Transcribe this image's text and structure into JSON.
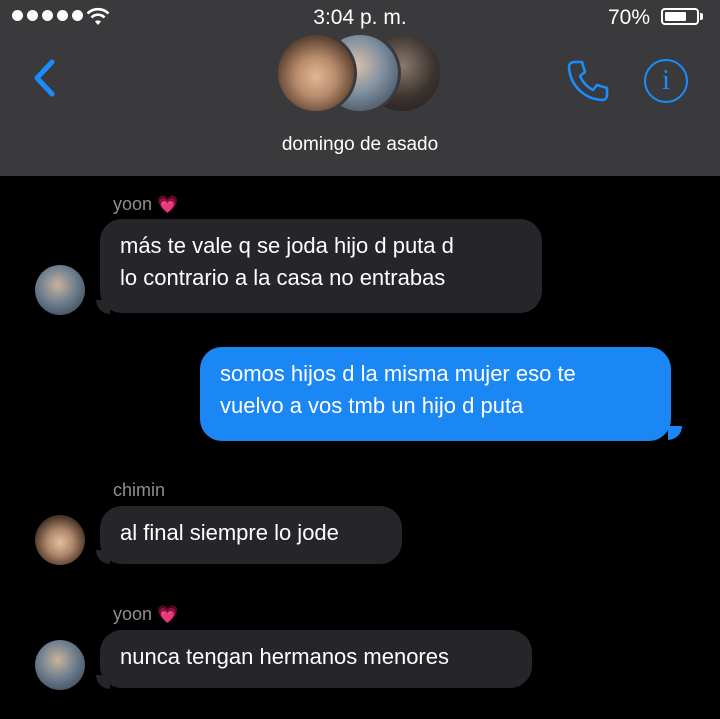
{
  "status_bar": {
    "time": "3:04 p. m.",
    "battery_percent": "70%",
    "battery_level": 0.7,
    "signal_dots": 5
  },
  "header": {
    "group_name": "domingo de asado",
    "back_icon": "chevron-left-icon",
    "call_icon": "phone-icon",
    "info_icon": "info-icon",
    "info_glyph": "i",
    "accent_color": "#1a8cff"
  },
  "messages": [
    {
      "sender": "yoon",
      "sender_emoji": "💗",
      "direction": "incoming",
      "lines": [
        "más te vale q se joda hijo d puta d",
        "lo contrario a la casa no entrabas"
      ]
    },
    {
      "direction": "outgoing",
      "lines": [
        "somos hijos d la misma mujer eso te",
        "vuelvo a vos tmb un hijo d puta"
      ]
    },
    {
      "sender": "chimin",
      "direction": "incoming",
      "lines": [
        "al final siempre lo jode"
      ]
    },
    {
      "sender": "yoon",
      "sender_emoji": "💗",
      "direction": "incoming",
      "lines": [
        "nunca tengan hermanos menores"
      ]
    }
  ],
  "colors": {
    "header_bg": "#3a3a3c",
    "incoming_bubble": "#26252a",
    "outgoing_bubble": "#1a87f5",
    "sender_label": "#8e8e93"
  }
}
